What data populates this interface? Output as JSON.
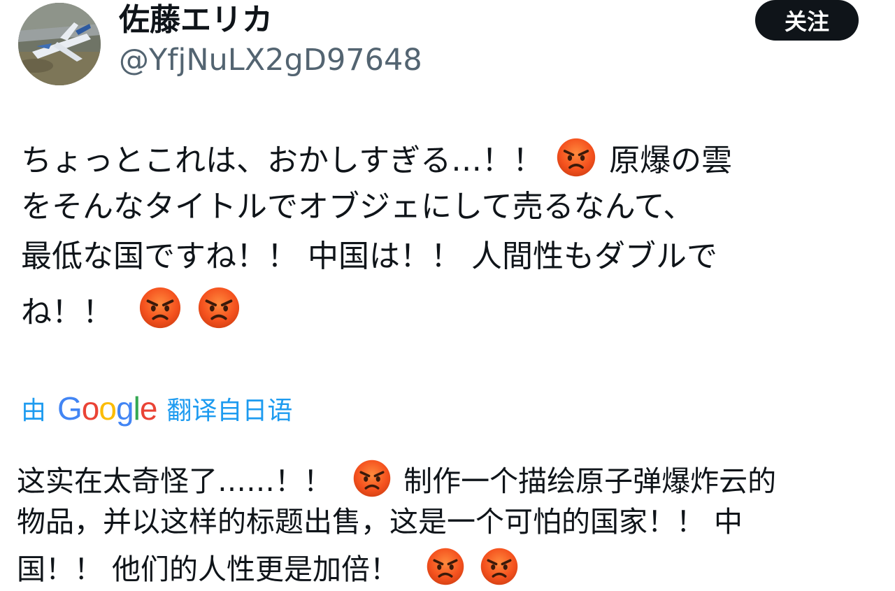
{
  "user": {
    "display_name": "佐藤エリカ",
    "handle": "@YfjNuLX2gD97648",
    "avatar_icon": "airplane-photo"
  },
  "follow_button": {
    "label": "关注"
  },
  "tweet": {
    "line1_a": "ちょっとこれは、おかしすぎる…！！",
    "line1_b": "原爆の雲",
    "line2": "をそんなタイトルでオブジェにして売るなんて、",
    "line3": "最低な国ですね！！ 中国は！！ 人間性もダブルで",
    "line4": "ね！！"
  },
  "translation": {
    "prefix": "由",
    "provider": "Google",
    "suffix": "翻译自日语",
    "line1_a": "这实在太奇怪了……！！",
    "line1_b": "制作一个描绘原子弹爆炸云的",
    "line2": "物品，并以这样的标题出售，这是一个可怕的国家！！ 中",
    "line3": "国！！ 他们的人性更是加倍！"
  },
  "colors": {
    "link_blue": "#1d9bf0",
    "handle_gray": "#536471",
    "text": "#0f1419",
    "button_bg": "#0f1419"
  }
}
